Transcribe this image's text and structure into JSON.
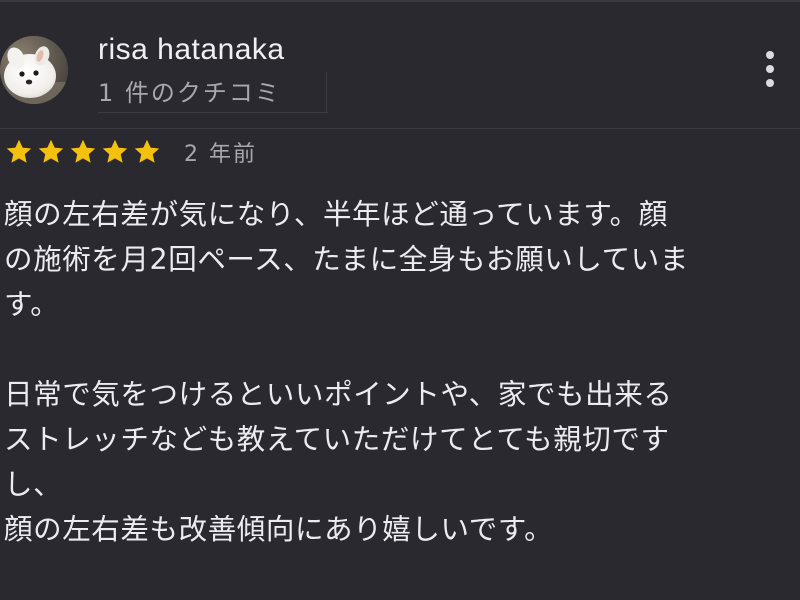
{
  "review": {
    "author_name": "risa hatanaka",
    "review_count": "1 件のクチコミ",
    "rating": 5,
    "star_color": "#f4c20d",
    "time_ago": "2 年前",
    "text": "顔の左右差が気になり、半年ほど通っています。顔\nの施術を月2回ペース、たまに全身もお願いしていま\nす。\n\n日常で気をつけるといいポイントや、家でも出来る\nストレッチなども教えていただけてとても親切です\nし、\n顔の左右差も改善傾向にあり嬉しいです。"
  },
  "icons": {
    "avatar": "white-dog-photo",
    "more": "more-vert-icon",
    "star": "star-icon"
  }
}
